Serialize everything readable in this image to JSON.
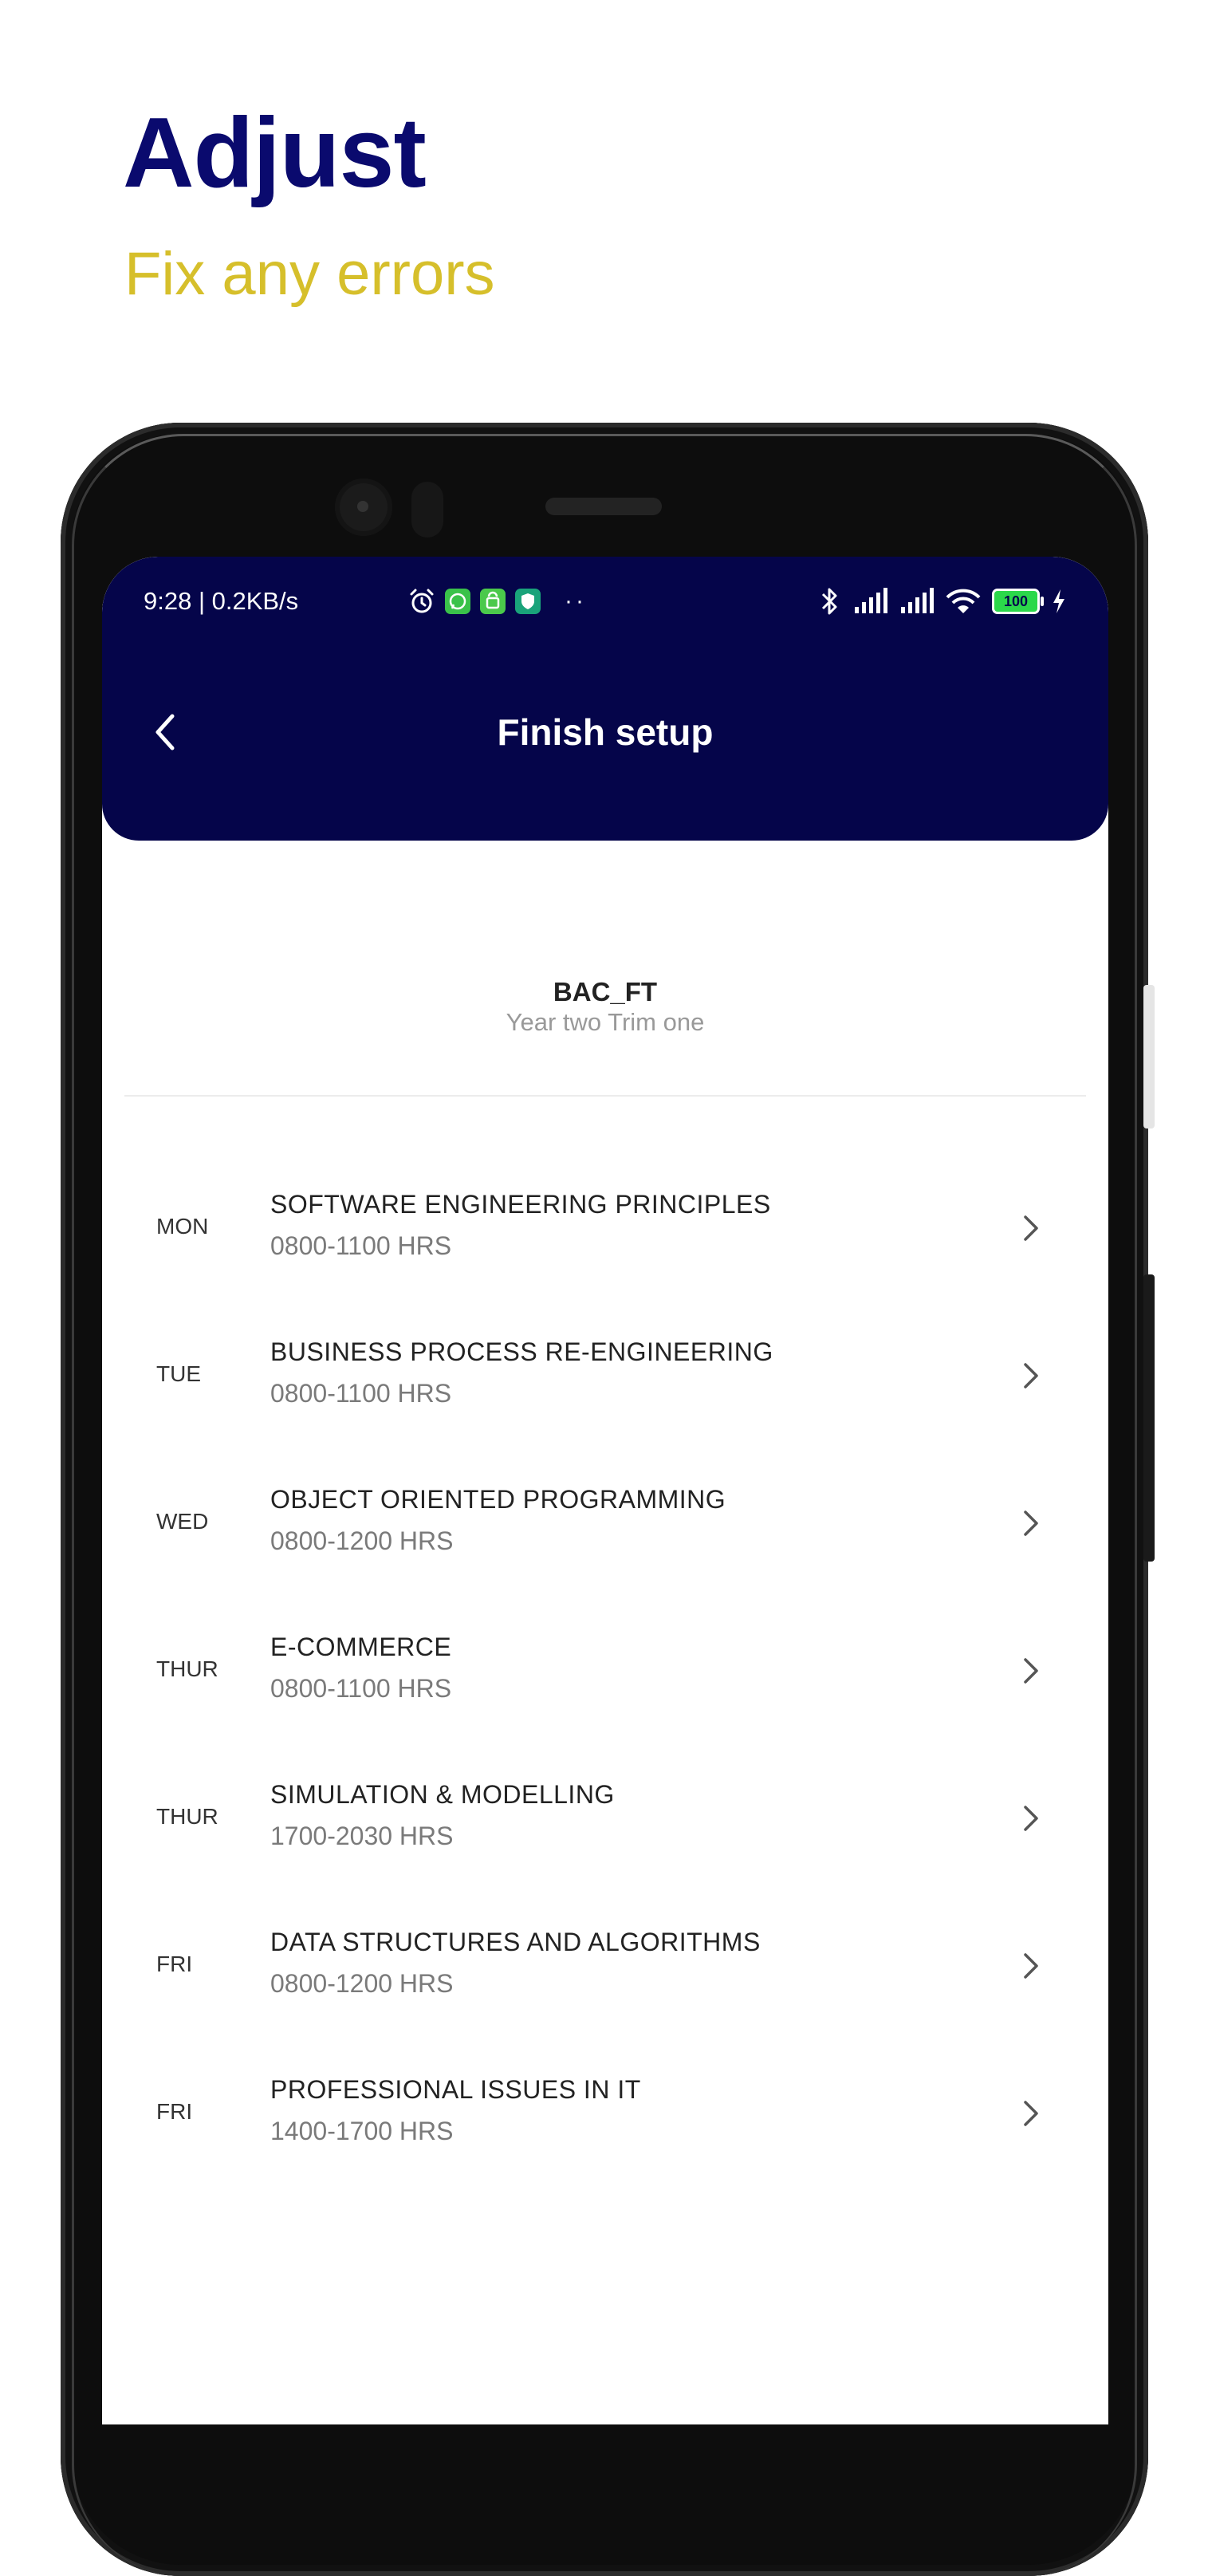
{
  "promo": {
    "title": "Adjust",
    "subtitle": "Fix any errors"
  },
  "status_bar": {
    "time_speed": "9:28 | 0.2KB/s",
    "battery": "100",
    "app_badge_colors": [
      "#3ac24a",
      "#4bc94b",
      "#1aa37a"
    ],
    "icons": [
      "alarm-icon",
      "whatsapp-icon",
      "android-icon",
      "vpn-shield-icon",
      "bluetooth-icon",
      "signal-icon",
      "signal-icon",
      "wifi-icon",
      "battery-icon",
      "charging-icon"
    ]
  },
  "header": {
    "title": "Finish setup",
    "background": "#05054a"
  },
  "course": {
    "code": "BAC_FT",
    "term": "Year two Trim one"
  },
  "schedule": [
    {
      "day": "MON",
      "subject": "SOFTWARE ENGINEERING PRINCIPLES",
      "time": "0800-1100 HRS"
    },
    {
      "day": "TUE",
      "subject": "BUSINESS PROCESS RE-ENGINEERING",
      "time": "0800-1100 HRS"
    },
    {
      "day": "WED",
      "subject": "OBJECT ORIENTED PROGRAMMING",
      "time": "0800-1200 HRS"
    },
    {
      "day": "THUR",
      "subject": "E-COMMERCE",
      "time": "0800-1100 HRS"
    },
    {
      "day": "THUR",
      "subject": "SIMULATION & MODELLING",
      "time": "1700-2030 HRS"
    },
    {
      "day": "FRI",
      "subject": "DATA STRUCTURES AND ALGORITHMS",
      "time": "0800-1200 HRS"
    },
    {
      "day": "FRI",
      "subject": "PROFESSIONAL ISSUES IN IT",
      "time": "1400-1700 HRS"
    }
  ]
}
